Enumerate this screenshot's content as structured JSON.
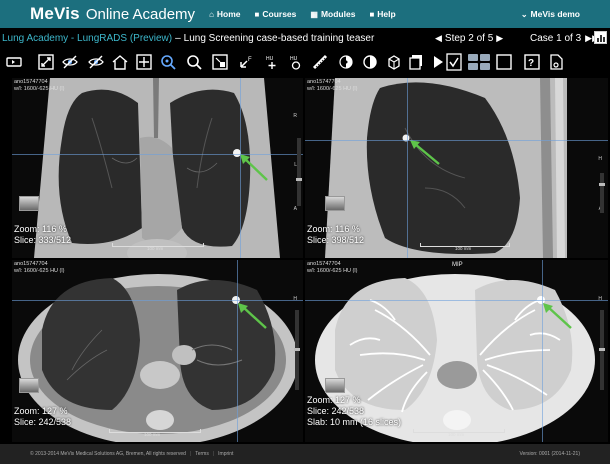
{
  "nav": {
    "brand": "MeVis",
    "brand_sub": "Online Academy",
    "items": [
      {
        "icon": "home-icon",
        "glyph": "⌂",
        "label": "Home"
      },
      {
        "icon": "courses-icon",
        "glyph": "■",
        "label": "Courses"
      },
      {
        "icon": "modules-icon",
        "glyph": "▦",
        "label": "Modules"
      },
      {
        "icon": "help-icon",
        "glyph": "■",
        "label": "Help"
      }
    ],
    "user_label": "MeVis demo"
  },
  "titlebar": {
    "crumb1": "Lung Academy - LungRADS (Preview)",
    "separator": "–",
    "crumb2": "Lung Screening case-based training teaser",
    "step_label": "Step 2 of 5",
    "case_label": "Case 1 of 3"
  },
  "viewports": {
    "top_left": {
      "id_line": "ano15747704",
      "wl_line": "w/l: 1600/-625 HU (l)",
      "zoom": "Zoom: 116 %",
      "slice": "Slice: 333/512",
      "scale": "100 mm",
      "letters": [
        "R",
        "L",
        "A"
      ]
    },
    "top_right": {
      "id_line": "ano15747704",
      "wl_line": "w/l: 1600/-625 HU (l)",
      "zoom": "Zoom: 116 %",
      "slice": "Slice: 398/512",
      "scale": "100 mm",
      "letters": [
        "H",
        "A"
      ]
    },
    "bottom_left": {
      "id_line": "ano15747704",
      "wl_line": "w/l: 1600/-625 HU (l)",
      "zoom": "Zoom: 127 %",
      "slice": "Slice: 242/538",
      "scale": "100 mm",
      "letters": [
        "H"
      ]
    },
    "bottom_right": {
      "label": "MIP",
      "id_line": "ano15747704",
      "wl_line": "w/l: 1600/-625 HU (l)",
      "zoom": "Zoom: 127 %",
      "slice": "Slice: 242/538",
      "slab": "Slab: 10 mm (16 slices)",
      "scale": "100 mm",
      "letters": [
        "H"
      ]
    }
  },
  "toolbar": {
    "tools": [
      "layout-toggle-icon",
      "fit-view-icon",
      "eye-off-icon",
      "eye-off-alt-icon",
      "home-view-icon",
      "crosshair-icon",
      "zoom-icon",
      "search-icon",
      "grid-icon",
      "pointer-f-icon",
      "hu-plus-icon",
      "hu-circle-icon",
      "ruler-icon",
      "contrast-icon",
      "window-icon",
      "cube-icon",
      "copy-icon",
      "play-icon",
      "checklist-icon",
      "layout-grid-icon",
      "single-view-icon",
      "question-icon",
      "document-icon"
    ]
  },
  "footer": {
    "copyright": "© 2013-2014 MeVis Medical Solutions AG, Bremen, All rights reserved",
    "terms": "Terms",
    "imprint": "Imprint",
    "version": "Version: 0001 (2014-11-21)"
  },
  "colors": {
    "nav_bg": "#1c6f7e",
    "link": "#3db8cc",
    "arrow": "#5ec44a"
  }
}
